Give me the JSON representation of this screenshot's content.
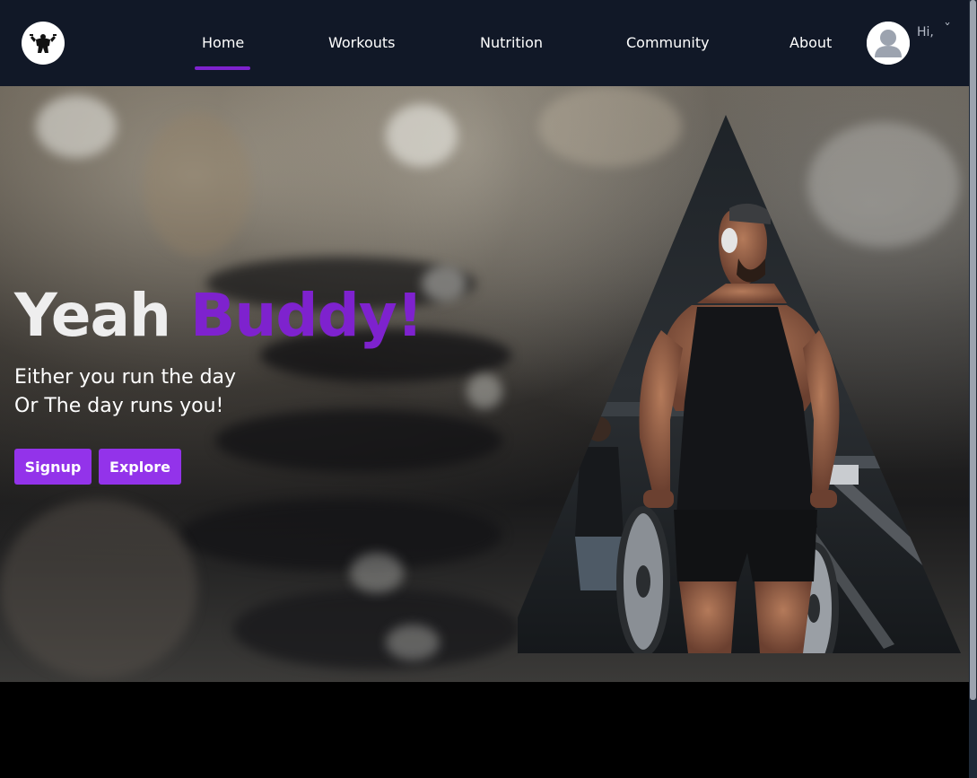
{
  "nav": {
    "logo_icon": "bodybuilder-logo-icon",
    "links": [
      "Home",
      "Workouts",
      "Nutrition",
      "Community",
      "About"
    ],
    "active": "Home",
    "greeting": "Hi,",
    "avatar_icon": "user-avatar-icon",
    "dropdown_icon": "chevron-down-icon"
  },
  "hero": {
    "title_main": "Yeah",
    "title_accent": "Buddy!",
    "subtitle_line1": "Either you run the day",
    "subtitle_line2": "Or The day runs you!",
    "signup_label": "Signup",
    "explore_label": "Explore"
  },
  "colors": {
    "nav_bg": "#111827",
    "accent": "#7e22ce",
    "button": "#9333ea"
  }
}
